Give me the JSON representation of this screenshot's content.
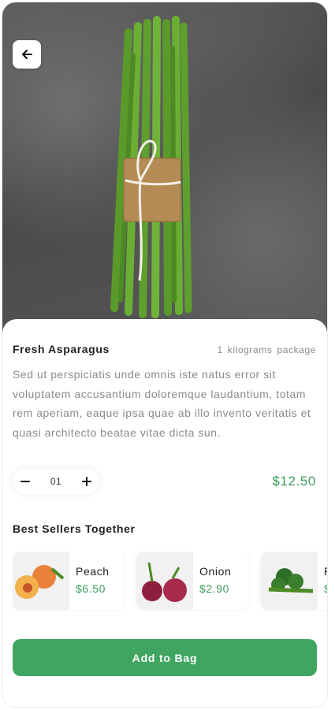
{
  "product": {
    "name": "Fresh Asparagus",
    "unit": "1 kilograms  package",
    "description": "Sed ut perspiciatis unde omnis iste natus error sit voluptatem accusantium doloremque laudantium, totam rem aperiam, eaque ipsa quae ab illo invento veritatis et quasi architecto beatae vitae dicta sun.",
    "price": "$12.50",
    "quantity": "01"
  },
  "controls": {
    "back_icon": "arrow-left-icon",
    "minus_icon": "minus-icon",
    "plus_icon": "plus-icon"
  },
  "best_sellers": {
    "title": "Best Sellers Together",
    "items": [
      {
        "name": "Peach",
        "price": "$6.50",
        "icon": "peach-image"
      },
      {
        "name": "Onion",
        "price": "$2.90",
        "icon": "onion-image"
      },
      {
        "name": "P",
        "price": "$",
        "icon": "broccoli-image"
      }
    ]
  },
  "cta": {
    "label": "Add to Bag"
  },
  "colors": {
    "accent": "#3fa561",
    "price_green": "#3a9d5d"
  }
}
